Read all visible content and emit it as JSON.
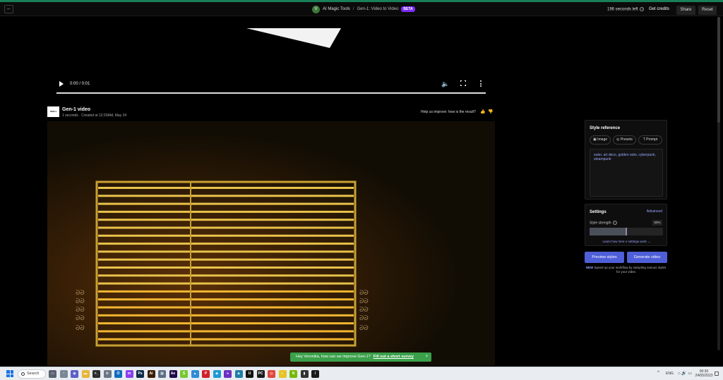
{
  "topbar": {
    "workspace_initial": "V",
    "crumb_root": "AI Magic Tools",
    "crumb_sep": "/",
    "crumb_page": "Gen-1: Video to Video",
    "beta": "BETA",
    "seconds_left": "196 seconds left",
    "info_glyph": "i",
    "get_credits": "Get credits",
    "share": "Share",
    "reset": "Reset",
    "back_glyph": "←"
  },
  "player": {
    "time": "0:00 / 0:01",
    "progress_fraction": 0.0,
    "volume_glyph": "🔈"
  },
  "output": {
    "logo_text": "GEN-1",
    "title": "Gen-1 video",
    "meta": "1 seconds · Created at 12:20AM, May 24",
    "feedback": "Help us improve: how is the result?",
    "thumb_up": "👍",
    "thumb_down": "👎"
  },
  "style_reference": {
    "title": "Style reference",
    "tabs": [
      {
        "label": "Image",
        "icon": "image-icon",
        "glyph": "▣"
      },
      {
        "label": "Presets",
        "icon": "presets-icon",
        "glyph": "◎"
      },
      {
        "label": "Prompt",
        "icon": "text-icon",
        "glyph": "T"
      }
    ],
    "prompt": "euler, art deco, golden ratio, cyberpunk, steampunk"
  },
  "settings": {
    "title": "Settings",
    "advanced": "Advanced",
    "strength_label": "Style strength",
    "strength_value": "50%",
    "strength_fraction": 0.5,
    "learn_link": "Learn how Gen-1 settings work →"
  },
  "actions": {
    "preview": "Preview styles",
    "generate": "Generate video",
    "new_tag": "NEW",
    "new_text": "Speed up your workflow by sampling various styles for your video"
  },
  "toast": {
    "text": "Hey Veronika, how can we improve Gen-1?",
    "link": "Fill out a short survey",
    "close": "×"
  },
  "taskbar": {
    "search": "Search",
    "apps": [
      {
        "name": "task-view-icon",
        "color": "#5a6270",
        "glyph": "▭"
      },
      {
        "name": "widgets-icon",
        "color": "#7a8894",
        "glyph": "◔"
      },
      {
        "name": "chat-icon",
        "color": "#5b5fc7",
        "glyph": "◉"
      },
      {
        "name": "file-explorer-icon",
        "color": "#e8b53a",
        "glyph": "▬"
      },
      {
        "name": "terminal-icon",
        "color": "#2b2b2b",
        "glyph": ">_"
      },
      {
        "name": "settings-icon",
        "color": "#6b7785",
        "glyph": "⚙"
      },
      {
        "name": "outlook-icon",
        "color": "#0f6cbd",
        "glyph": "O"
      },
      {
        "name": "messenger-icon",
        "color": "#8a3ff0",
        "glyph": "m"
      },
      {
        "name": "photoshop-icon",
        "color": "#0f2a4a",
        "glyph": "Ps"
      },
      {
        "name": "illustrator-icon",
        "color": "#3a1d00",
        "glyph": "Ai"
      },
      {
        "name": "media-icon",
        "color": "#5d6f86",
        "glyph": "▦"
      },
      {
        "name": "after-effects-icon",
        "color": "#1f0a4a",
        "glyph": "Ae"
      },
      {
        "name": "app-s-icon",
        "color": "#78c832",
        "glyph": "S"
      },
      {
        "name": "photos-icon",
        "color": "#2e8bd6",
        "glyph": "▲"
      },
      {
        "name": "pinterest-icon",
        "color": "#d0202a",
        "glyph": "P"
      },
      {
        "name": "app-blue-icon",
        "color": "#1c9ad6",
        "glyph": "◆"
      },
      {
        "name": "visual-studio-icon",
        "color": "#6a2fc0",
        "glyph": "∞"
      },
      {
        "name": "app-teal-icon",
        "color": "#1e7fa8",
        "glyph": "◈"
      },
      {
        "name": "unreal-icon",
        "color": "#111111",
        "glyph": "U"
      },
      {
        "name": "pycharm-icon",
        "color": "#1b1b1b",
        "glyph": "PC"
      },
      {
        "name": "chrome-icon",
        "color": "#e0473c",
        "glyph": "◎"
      },
      {
        "name": "app-yellow-icon",
        "color": "#e5c427",
        "glyph": "◐"
      },
      {
        "name": "nvidia-icon",
        "color": "#76b900",
        "glyph": "N"
      },
      {
        "name": "app-dark-icon",
        "color": "#333333",
        "glyph": "▮"
      },
      {
        "name": "runway-icon",
        "color": "#1a1a1a",
        "glyph": "/"
      }
    ],
    "chevron": "^",
    "lang": "ENG",
    "tray_glyphs": "⌂ 🔊 ▭",
    "time": "00:30",
    "date": "24/05/2023"
  }
}
